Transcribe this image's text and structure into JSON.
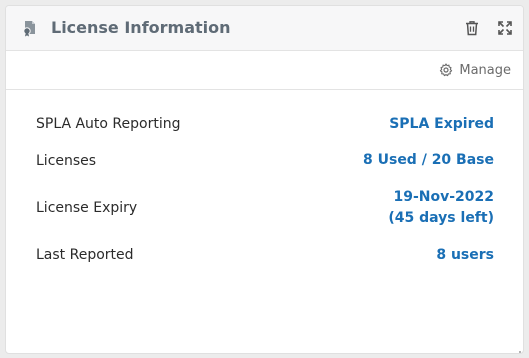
{
  "widget": {
    "title": "License Information",
    "manage_label": "Manage"
  },
  "rows": [
    {
      "label": "SPLA Auto Reporting",
      "value": "SPLA Expired"
    },
    {
      "label": "Licenses",
      "value": "8 Used / 20 Base"
    },
    {
      "label": "License Expiry",
      "value_line1": "19-Nov-2022",
      "value_line2": "(45 days left)"
    },
    {
      "label": "Last Reported",
      "value": "8 users"
    }
  ],
  "colors": {
    "accent": "#1a6fb5",
    "header_bg": "#f7f7f8",
    "title": "#5f6b76"
  }
}
